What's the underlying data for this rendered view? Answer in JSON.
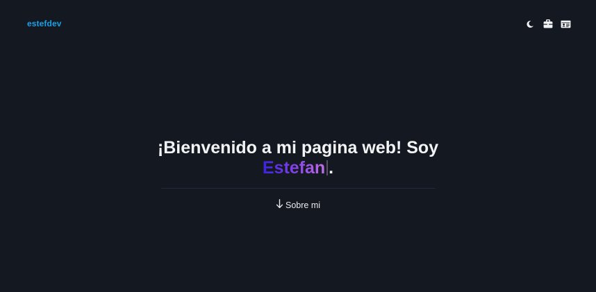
{
  "header": {
    "brand": "estefdev",
    "icons": [
      "moon-icon",
      "briefcase-icon",
      "id-card-icon"
    ]
  },
  "hero": {
    "title_prefix": "¡Bienvenido a mi pagina web! Soy",
    "name": "Estefan",
    "title_suffix": ".",
    "about_label": "Sobre mi"
  },
  "colors": {
    "background": "#141821",
    "brand": "#1aa0e6",
    "gradient_start": "#3b22dd",
    "gradient_end": "#c16ee8"
  }
}
